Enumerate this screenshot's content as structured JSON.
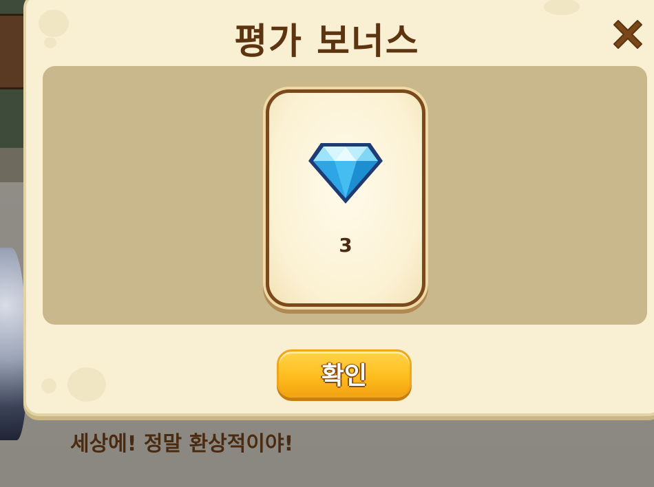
{
  "popup": {
    "title": "평가 보너스",
    "close_icon": "close-x-icon",
    "reward": {
      "icon": "diamond-gem-icon",
      "count": "3"
    },
    "confirm_label": "확인"
  },
  "dialogue": {
    "text": "세상에! 정말 환상적이야!"
  },
  "colors": {
    "title_text": "#5c3410",
    "panel_bg": "#f9f0d4",
    "reward_area_bg": "#c9b88c",
    "button_yellow": "#ffbe1f",
    "gem_blue": "#3fb6ef"
  }
}
